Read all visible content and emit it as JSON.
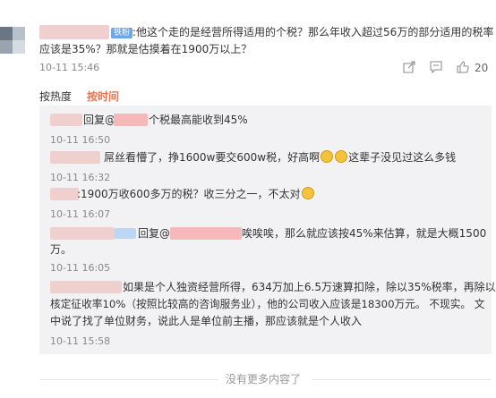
{
  "main_comment": {
    "badge": "铁粉",
    "text_line1": ":他这个走的是经营所得适用的个税？那么年收入超过56万的部分适用的税率",
    "text_line2": "应该是35%？那就是估摸着在1900万以上？",
    "time": "10-11 15:46",
    "like_count": "20"
  },
  "sort": {
    "hot": "按热度",
    "time": "按时间"
  },
  "replies": [
    {
      "prefix": "回复@",
      "text": "个税最高能收到45%",
      "time": "10-11 16:50"
    },
    {
      "text_a": "屌丝看懵了，挣1600w要交600w税，好高啊",
      "text_b": "这辈子没见过这么多钱",
      "time": "10-11 16:32"
    },
    {
      "text": ":1900万收600多万的税？收三分之一，不太对",
      "time": "10-11 16:07"
    },
    {
      "prefix": "回复@",
      "text_line1": "唉唉唉，那么就应该按45%来估算，就是大概1500",
      "text_line2": "万。",
      "time": "10-11 16:05"
    },
    {
      "text_line1": "如果是个人独资经营所得，634万加上6.5万速算扣除，除以35%税率，再除以",
      "text_line2": "核定征收率10%（按照比较高的咨询服务业），他的公司收入应该是18300万元。 不现实。 文",
      "text_line3": "中说了找了单位财务，说此人是单位前主播，那应该就是个人收入",
      "time": "10-11 15:58"
    }
  ],
  "footer": {
    "no_more": "没有更多内容了"
  },
  "colors": {
    "accent": "#eb7350",
    "badge": "#6ea6e6"
  }
}
